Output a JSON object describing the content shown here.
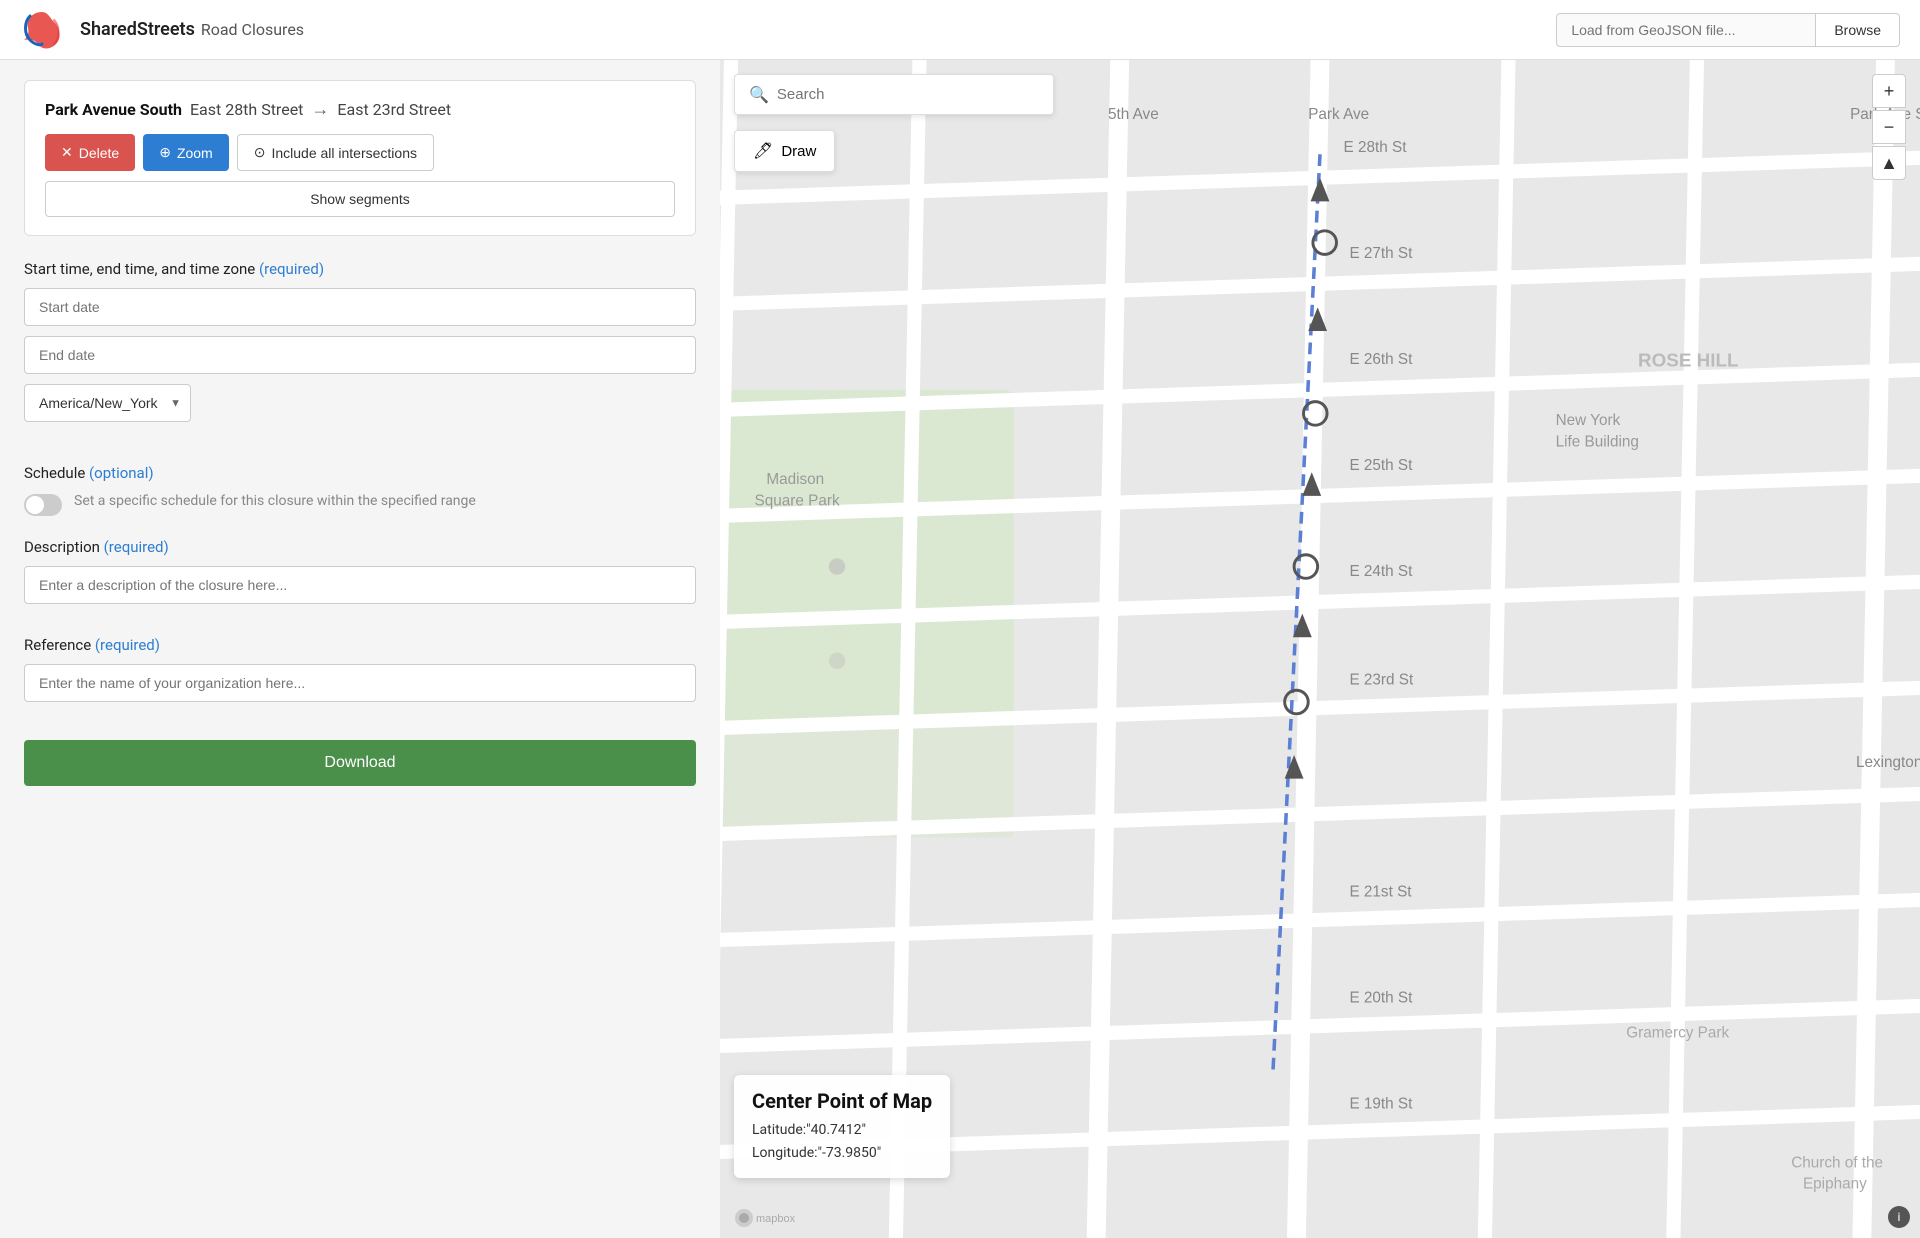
{
  "header": {
    "app_name": "SharedStreets",
    "page_name": "Road Closures",
    "geojson_placeholder": "Load from GeoJSON file...",
    "browse_label": "Browse"
  },
  "closure": {
    "street": "Park Avenue South",
    "from": "East 28th Street",
    "to": "East 23rd Street",
    "delete_label": "Delete",
    "zoom_label": "Zoom",
    "include_label": "Include all intersections",
    "show_segments_label": "Show segments"
  },
  "form": {
    "time_section_label": "Start time, end time, and time zone",
    "time_required": "(required)",
    "start_date_placeholder": "Start date",
    "end_date_placeholder": "End date",
    "timezone_value": "America/New_York",
    "schedule_section_label": "Schedule",
    "schedule_optional": "(optional)",
    "schedule_toggle_label": "Set a specific schedule for this closure within the specified range",
    "description_section_label": "Description",
    "description_required": "(required)",
    "description_placeholder": "Enter a description of the closure here...",
    "reference_section_label": "Reference",
    "reference_required": "(required)",
    "reference_placeholder": "Enter the name of your organization here...",
    "download_label": "Download"
  },
  "map": {
    "search_placeholder": "Search",
    "draw_label": "Draw",
    "zoom_plus": "+",
    "zoom_minus": "−",
    "zoom_up": "▲",
    "center_point_title": "Center Point of Map",
    "latitude_label": "Latitude:\"40.7412\"",
    "longitude_label": "Longitude:\"-73.9850\"",
    "info_label": "i"
  }
}
